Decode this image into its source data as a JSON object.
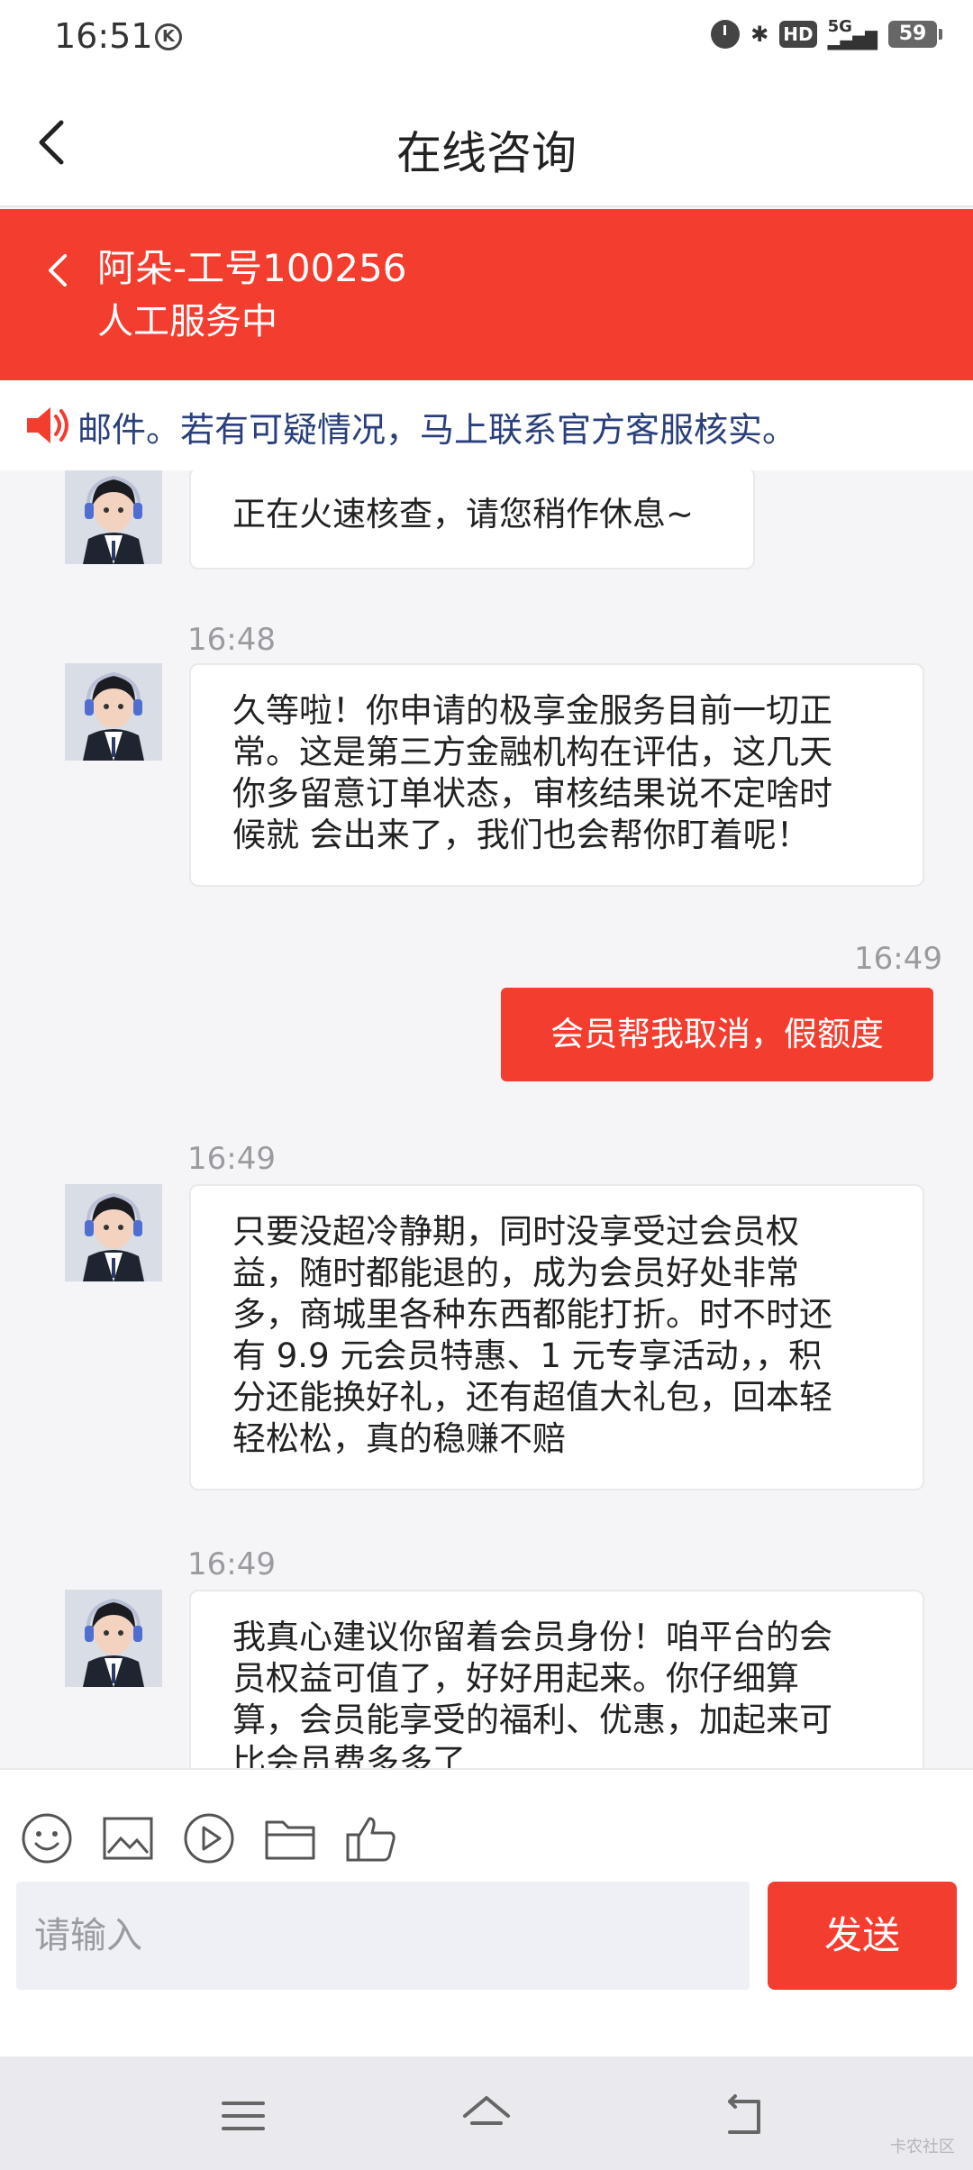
{
  "status_bar": {
    "time": "16:51",
    "k_badge": "K",
    "hd": "HD",
    "network": "5G",
    "battery": "59"
  },
  "title_bar": {
    "title": "在线咨询"
  },
  "agent": {
    "name": "阿朵-工号100256",
    "status": "人工服务中"
  },
  "notice": {
    "text": "邮件。若有可疑情况，马上联系官方客服核实。"
  },
  "messages": [
    {
      "from": "agent",
      "time": "",
      "lines": [
        "正在火速核查，请您稍作休息~"
      ]
    },
    {
      "from": "agent",
      "time": "16:48",
      "lines": [
        "久等啦！你申请的极享金服务目前一切正",
        "常。这是第三方金融机构在评估，这几天",
        "你多留意订单状态，审核结果说不定啥时",
        "候就 会出来了，我们也会帮你盯着呢！"
      ]
    },
    {
      "from": "user",
      "time": "16:49",
      "lines": [
        "会员帮我取消，假额度"
      ]
    },
    {
      "from": "agent",
      "time": "16:49",
      "lines": [
        "只要没超冷静期，同时没享受过会员权",
        "益，随时都能退的，成为会员好处非常",
        "多，商城里各种东西都能打折。时不时还",
        "有 9.9 元会员特惠、1 元专享活动，，积",
        "分还能换好礼，还有超值大礼包，回本轻",
        "轻松松，真的稳赚不赔"
      ]
    },
    {
      "from": "agent",
      "time": "16:49",
      "lines": [
        "我真心建议你留着会员身份！咱平台的会",
        "员权益可值了，好好用起来。你仔细算",
        "算，会员能享受的福利、优惠，加起来可",
        "比会员费多多了"
      ]
    }
  ],
  "composer": {
    "placeholder": "请输入",
    "send_label": "发送"
  },
  "watermark": "卡农社区",
  "colors": {
    "brand": "#f33d2f",
    "notice_text": "#2a3f7c",
    "background": "#f5f5f7"
  }
}
